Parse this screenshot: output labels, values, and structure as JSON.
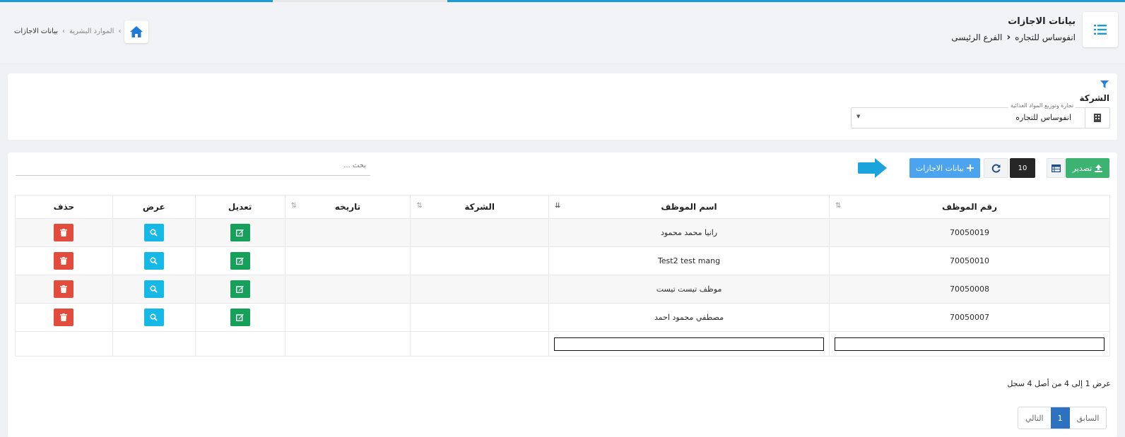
{
  "header": {
    "title": "بيانات الاجازات",
    "company": "انفوساس للتجاره",
    "branch": "الفرع الرئيسى",
    "breadcrumb": [
      "الموارد البشرية",
      "بيانات الاجازات"
    ]
  },
  "filter": {
    "label": "الشركة",
    "company_select": {
      "floating_label": "تجارة وتوزيع المواد الغذائية",
      "value": "انفوساس للتجاره"
    }
  },
  "toolbar": {
    "export_label": "تصدير",
    "page_length": "10",
    "add_label": "بيانات الاجازات",
    "search_placeholder": "بحث ..."
  },
  "table": {
    "columns": [
      "رقم الموظف",
      "اسم الموظف",
      "الشركة",
      "تاريخه",
      "تعديل",
      "عرض",
      "حذف"
    ],
    "rows": [
      {
        "id": "70050019",
        "name": "رانيا محمد محمود",
        "company": "",
        "date": ""
      },
      {
        "id": "70050010",
        "name": "Test2 test mang",
        "company": "",
        "date": ""
      },
      {
        "id": "70050008",
        "name": "موظف تيست تيست",
        "company": "",
        "date": ""
      },
      {
        "id": "70050007",
        "name": "مصطفي محمود احمد",
        "company": "",
        "date": ""
      }
    ]
  },
  "footer": {
    "info": "عرض 1 إلى 4 من أصل 4 سجل",
    "pager": {
      "previous": "السابق",
      "current": "1",
      "next": "التالي"
    }
  },
  "colors": {
    "accent": "#1a9bd6",
    "export_green": "#3cb371",
    "add_blue": "#4ca4ef",
    "edit_green": "#16a05a",
    "view_cyan": "#16b8e6",
    "delete_red": "#e24c3d",
    "pager_active": "#2d72c0"
  },
  "icons": [
    "list-icon",
    "home-icon",
    "filter-icon",
    "building-icon",
    "upload-icon",
    "table-icon",
    "refresh-icon",
    "plus-icon",
    "arrow-right-icon",
    "sort-icon",
    "edit-icon",
    "search-icon",
    "trash-icon"
  ]
}
